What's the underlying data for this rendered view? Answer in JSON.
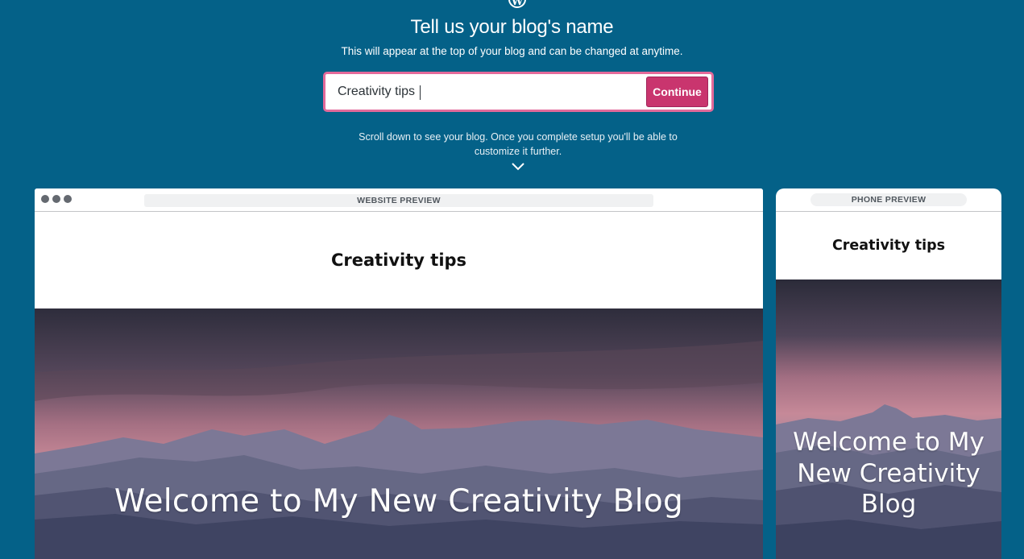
{
  "header": {
    "logo_icon": "wordpress-logo-icon",
    "logo_letter": "W",
    "title": "Tell us your blog's name",
    "subtitle": "This will appear at the top of your blog and can be changed at anytime."
  },
  "name_form": {
    "value": "Creativity tips",
    "continue_label": "Continue",
    "accent_color": "#c9356e"
  },
  "scroll_hint": {
    "text": "Scroll down to see your blog. Once you complete setup you'll be able to customize it further.",
    "icon": "chevron-down-icon"
  },
  "website_preview": {
    "label": "WEBSITE PREVIEW",
    "site_title": "Creativity tips",
    "hero_heading": "Welcome to My New Creativity Blog"
  },
  "phone_preview": {
    "label": "PHONE PREVIEW",
    "site_title": "Creativity tips",
    "hero_heading": "Welcome to My New Creativity Blog"
  },
  "colors": {
    "background": "#046188",
    "field_border": "#e36a9a"
  }
}
